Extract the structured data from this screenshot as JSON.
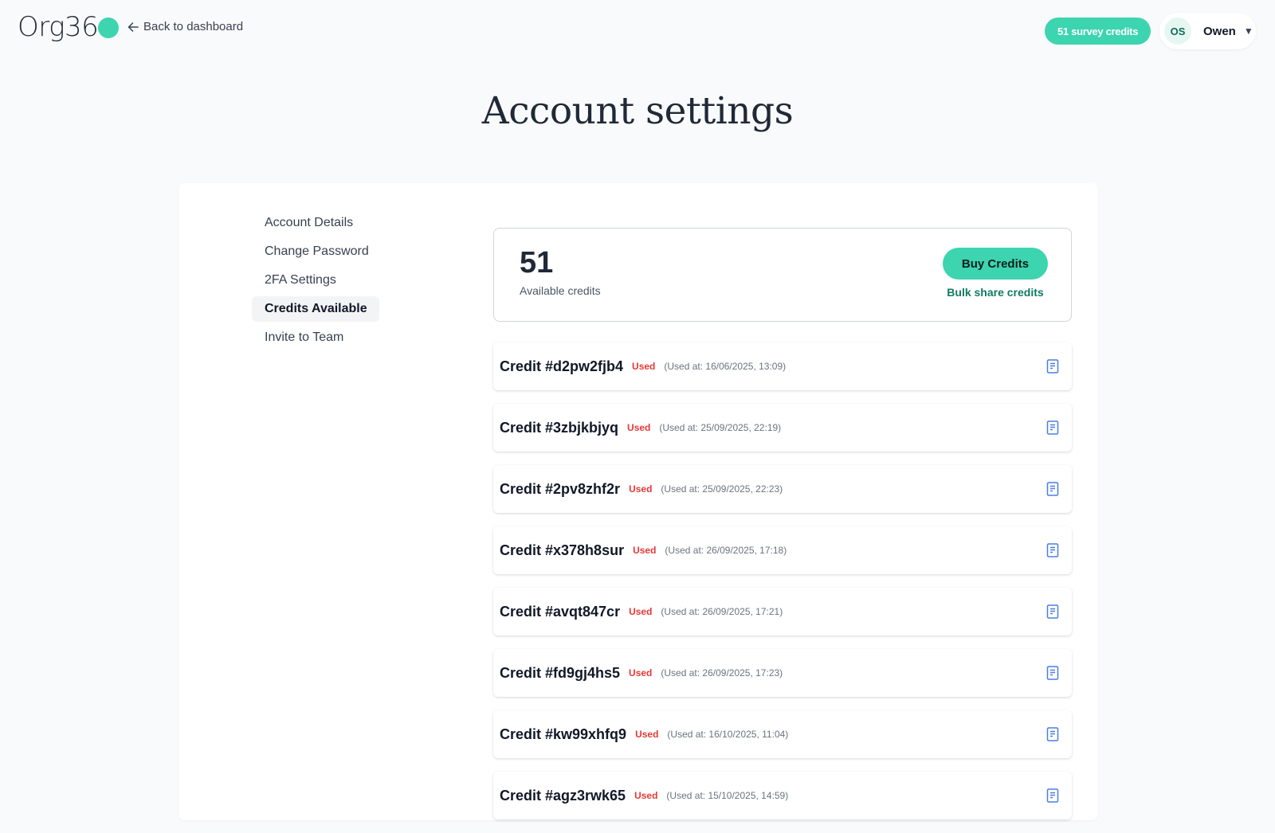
{
  "header": {
    "logo_text": "Org36",
    "back_label": "Back to dashboard",
    "credits_badge": "51 survey credits",
    "user": {
      "initials": "OS",
      "name": "Owen",
      "caret": "▼"
    }
  },
  "page_title": "Account settings",
  "sidebar": {
    "items": [
      {
        "label": "Account Details",
        "active": false
      },
      {
        "label": "Change Password",
        "active": false
      },
      {
        "label": "2FA Settings",
        "active": false
      },
      {
        "label": "Credits Available",
        "active": true
      },
      {
        "label": "Invite to Team",
        "active": false
      }
    ]
  },
  "summary": {
    "count": "51",
    "label": "Available credits",
    "buy_label": "Buy Credits",
    "bulk_label": "Bulk share credits"
  },
  "credits": [
    {
      "id": "Credit #d2pw2fjb4",
      "status": "Used",
      "used_at": "(Used at: 16/06/2025, 13:09)"
    },
    {
      "id": "Credit #3zbjkbjyq",
      "status": "Used",
      "used_at": "(Used at: 25/09/2025, 22:19)"
    },
    {
      "id": "Credit #2pv8zhf2r",
      "status": "Used",
      "used_at": "(Used at: 25/09/2025, 22:23)"
    },
    {
      "id": "Credit #x378h8sur",
      "status": "Used",
      "used_at": "(Used at: 26/09/2025, 17:18)"
    },
    {
      "id": "Credit #avqt847cr",
      "status": "Used",
      "used_at": "(Used at: 26/09/2025, 17:21)"
    },
    {
      "id": "Credit #fd9gj4hs5",
      "status": "Used",
      "used_at": "(Used at: 26/09/2025, 17:23)"
    },
    {
      "id": "Credit #kw99xhfq9",
      "status": "Used",
      "used_at": "(Used at: 16/10/2025, 11:04)"
    },
    {
      "id": "Credit #agz3rwk65",
      "status": "Used",
      "used_at": "(Used at: 15/10/2025, 14:59)"
    }
  ],
  "colors": {
    "accent": "#3dd4b0",
    "status_used": "#e53935",
    "link": "#0f7a63",
    "doc_icon": "#4a7fe0"
  },
  "icons": {
    "back": "arrow-left-icon",
    "document": "document-icon",
    "caret": "caret-down-icon"
  }
}
